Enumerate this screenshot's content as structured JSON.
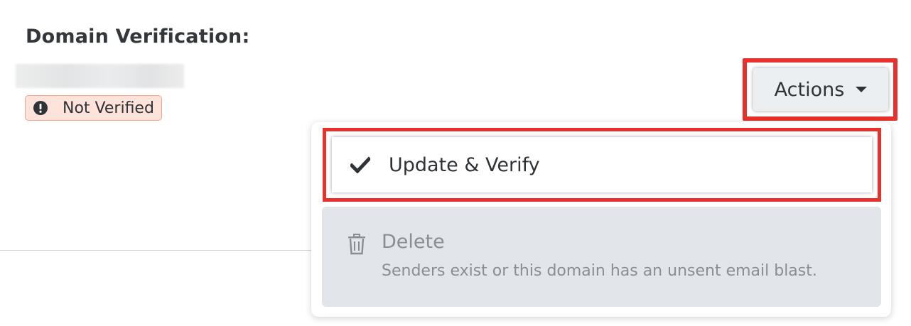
{
  "section": {
    "title": "Domain Verification:"
  },
  "domain": {
    "status_label": "Not Verified",
    "status_icon": "exclamation-circle-icon",
    "status_colors": {
      "background": "#fde3da",
      "border": "#f0a48e"
    }
  },
  "actions": {
    "button_label": "Actions",
    "menu": {
      "update": {
        "label": "Update & Verify",
        "icon": "checkmark-icon"
      },
      "delete": {
        "label": "Delete",
        "description": "Senders exist or this domain has an unsent email blast.",
        "icon": "trash-icon",
        "disabled": true
      }
    }
  },
  "highlight_color": "#e8302c"
}
